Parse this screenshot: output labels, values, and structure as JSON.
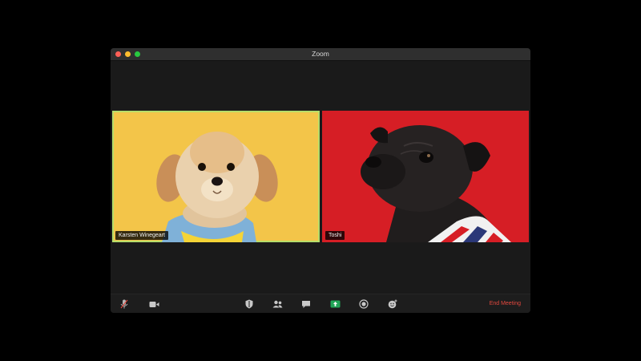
{
  "window": {
    "title": "Zoom"
  },
  "participants": [
    {
      "name": "Karsten Winegeart",
      "tile_color": "#f3c549",
      "active_speaker_color": "#b6dd6a"
    },
    {
      "name": "Toshi",
      "tile_color": "#d61e25"
    }
  ],
  "toolbar": {
    "icons": [
      "microphone-icon",
      "video-camera-icon",
      "security-shield-icon",
      "participants-icon",
      "chat-icon",
      "share-screen-icon",
      "record-icon",
      "reactions-icon"
    ],
    "end_meeting_label": "End Meeting",
    "share_color": "#21a557",
    "end_color": "#e4483e"
  }
}
